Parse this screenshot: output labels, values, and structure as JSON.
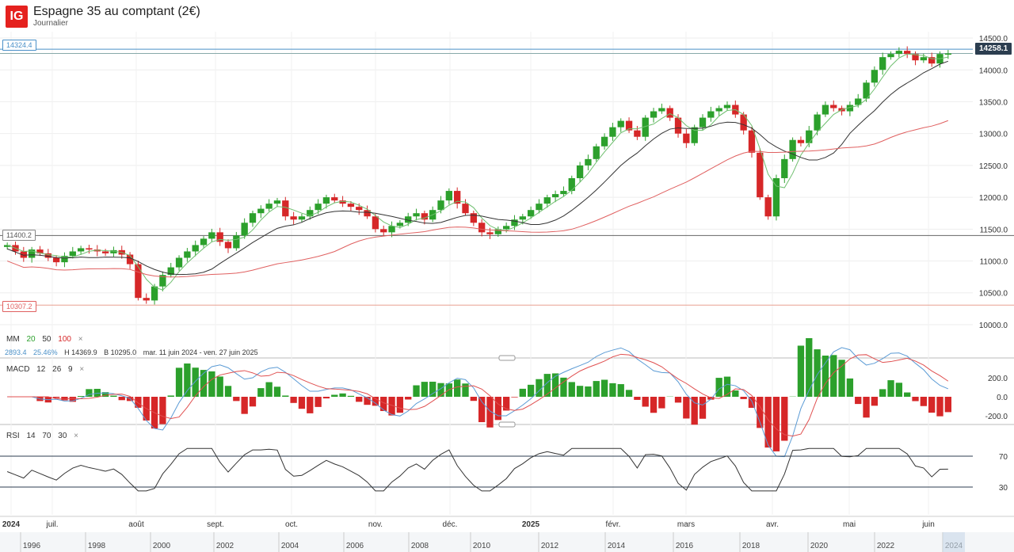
{
  "header": {
    "logo": "IG",
    "title": "Espagne 35 au comptant (2€)",
    "subtitle": "Journalier"
  },
  "colors": {
    "up": "#2ca02c",
    "down": "#d62728",
    "ma20": "#6fbf6f",
    "ma50": "#333333",
    "ma100": "#e06060",
    "macd": "#5b9bd5",
    "signal": "#e05050",
    "rsi_over": "#e04040",
    "level_blue": "#4a90c8"
  },
  "levels": {
    "top": "14324.4",
    "mid": "11400.2",
    "low": "10307.2",
    "current": "14258.1"
  },
  "ma_legend": {
    "name": "MM",
    "p1": "20",
    "p2": "50",
    "p3": "100",
    "close": "×"
  },
  "stats": {
    "change": "2893.4",
    "pct": "25.46%",
    "high": "H 14369.9",
    "low": "B 10295.0",
    "range": "mar. 11 juin 2024 - ven. 27 juin 2025"
  },
  "macd_legend": {
    "name": "MACD",
    "p1": "12",
    "p2": "26",
    "p3": "9",
    "close": "×"
  },
  "rsi_legend": {
    "name": "RSI",
    "p1": "14",
    "p2": "70",
    "p3": "30",
    "close": "×"
  },
  "chart_data": {
    "type": "candlestick",
    "price_axis": {
      "ticks": [
        "14500.0",
        "14000.0",
        "13500.0",
        "13000.0",
        "12500.0",
        "12000.0",
        "11500.0",
        "11000.0",
        "10500.0",
        "10000.0"
      ],
      "ylim": [
        9900,
        14600
      ]
    },
    "macd_axis": {
      "ticks": [
        "200.0",
        "0.0",
        "-200.0"
      ]
    },
    "rsi_axis": {
      "ticks": [
        "70",
        "30"
      ]
    },
    "x_labels": [
      "2024",
      "juil.",
      "août",
      "sept.",
      "oct.",
      "nov.",
      "déc.",
      "2025",
      "févr.",
      "mars",
      "avr.",
      "mai",
      "juin"
    ],
    "navigator_labels": [
      "1996",
      "1998",
      "2000",
      "2002",
      "2004",
      "2006",
      "2008",
      "2010",
      "2012",
      "2014",
      "2016",
      "2018",
      "2020",
      "2022",
      "2024"
    ],
    "close_path": [
      11250,
      11150,
      11050,
      11180,
      11120,
      11050,
      10980,
      11080,
      11150,
      11200,
      11180,
      11150,
      11120,
      11170,
      11100,
      10950,
      10420,
      10380,
      10600,
      10780,
      10900,
      11050,
      11150,
      11250,
      11350,
      11450,
      11300,
      11200,
      11400,
      11600,
      11750,
      11820,
      11900,
      11950,
      11700,
      11650,
      11700,
      11800,
      11900,
      12000,
      11950,
      11900,
      11850,
      11800,
      11700,
      11500,
      11450,
      11550,
      11600,
      11700,
      11750,
      11650,
      11800,
      11950,
      12100,
      11900,
      11750,
      11600,
      11450,
      11420,
      11500,
      11550,
      11650,
      11700,
      11800,
      11900,
      12000,
      12050,
      12100,
      12300,
      12500,
      12600,
      12800,
      12950,
      13100,
      13200,
      13050,
      12950,
      13250,
      13350,
      13400,
      13250,
      13000,
      12850,
      13100,
      13250,
      13350,
      13400,
      13450,
      13300,
      13050,
      12700,
      12000,
      11700,
      12300,
      12600,
      12900,
      12850,
      13050,
      13300,
      13450,
      13400,
      13350,
      13450,
      13550,
      13800,
      14000,
      14200,
      14250,
      14300,
      14250,
      14150,
      14200,
      14100,
      14250,
      14258
    ]
  }
}
